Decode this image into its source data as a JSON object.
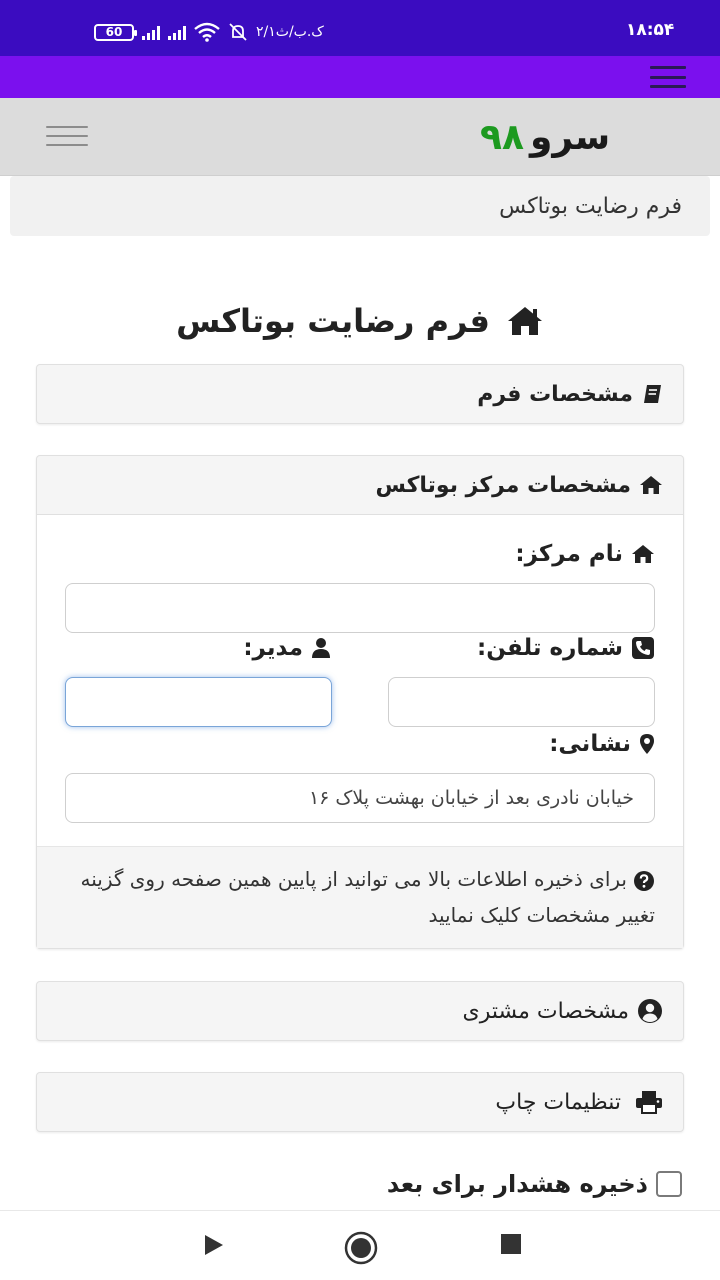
{
  "status_bar": {
    "time": "۱۸:۵۴",
    "battery": "60",
    "data_speed": "۲/۱ک.ب/ث"
  },
  "site": {
    "logo_word": "سرو",
    "logo_number": "۹۸"
  },
  "breadcrumb": {
    "text": "فرم رضایت بوتاکس"
  },
  "page": {
    "title": "فرم رضایت بوتاکس"
  },
  "sections": {
    "form_details": {
      "label": "مشخصات فرم",
      "icon": "book-icon"
    },
    "center_details": {
      "label": "مشخصات مرکز بوتاکس",
      "icon": "home-icon"
    },
    "customer_details": {
      "label": "مشخصات مشتری",
      "icon": "user-circle-icon"
    },
    "print_settings": {
      "label": "تنظیمات چاپ",
      "icon": "print-icon"
    }
  },
  "center_form": {
    "center_name_label": "نام مرکز:",
    "center_name_value": "",
    "phone_label": "شماره تلفن:",
    "phone_value": "",
    "manager_label": "مدیر:",
    "manager_value": "",
    "address_label": "نشانی:",
    "address_value": "خیابان نادری بعد از خیابان بهشت پلاک ۱۶",
    "help_text": "برای ذخیره اطلاعات بالا می توانید از پایین همین صفحه روی گزینه تغییر مشخصات کلیک نمایید"
  },
  "save_option": {
    "label": "ذخیره هشدار برای بعد",
    "checked": false
  },
  "colors": {
    "status_bar": "#3b0cc0",
    "app_bar": "#7b10ee",
    "logo_number": "#1d9a20"
  }
}
